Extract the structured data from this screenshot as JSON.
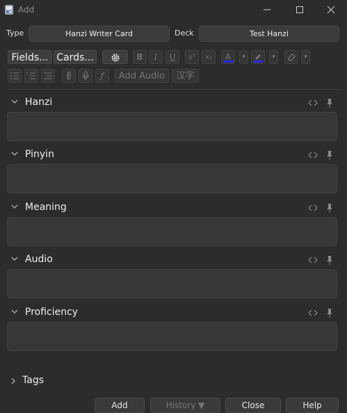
{
  "window": {
    "title": "Add"
  },
  "type_row": {
    "type_label": "Type",
    "type_value": "Hanzi Writer Card",
    "deck_label": "Deck",
    "deck_value": "Test Hanzi"
  },
  "toolbar": {
    "fields_label": "Fields...",
    "cards_label": "Cards...",
    "bold": "B",
    "italic": "I",
    "underline": "U",
    "superscript": "x²",
    "subscript": "x₂",
    "text_color": "A",
    "add_audio_label": "Add Audio",
    "hanzi_label": "汉字",
    "text_color_hex": "#2a2aee",
    "highlight_color_hex": "#2a2aee"
  },
  "fields": [
    {
      "name": "Hanzi",
      "value": ""
    },
    {
      "name": "Pinyin",
      "value": ""
    },
    {
      "name": "Meaning",
      "value": ""
    },
    {
      "name": "Audio",
      "value": ""
    },
    {
      "name": "Proficiency",
      "value": ""
    }
  ],
  "tags": {
    "label": "Tags"
  },
  "bottom_buttons": [
    "Add",
    "History ▼",
    "Close",
    "Help"
  ]
}
